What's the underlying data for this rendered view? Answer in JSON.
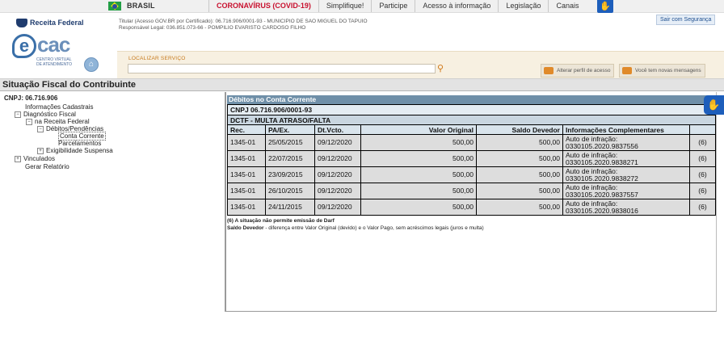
{
  "govbar": {
    "country": "BRASIL",
    "links": [
      "CORONAVÍRUS (COVID-19)",
      "Simplifique!",
      "Participe",
      "Acesso à informação",
      "Legislação",
      "Canais"
    ],
    "accessibility_icon": "hand-accessibility-icon"
  },
  "header": {
    "rf_logo": "Receita Federal",
    "ecac_e": "e",
    "ecac_cac": "cac",
    "ecac_sub": "CENTRO VIRTUAL DE ATENDIMENTO",
    "titular_line1": "Titular (Acesso GOV.BR por Certificado): 06.716.906/0001-93 - MUNICIPIO DE SAO MIGUEL DO TAPUIO",
    "titular_line2": "Responsável Legal: 036.851.073-66 - POMPILIO EVARISTO CARDOSO FILHO",
    "exit_label": "Sair com Segurança",
    "search_label": "LOCALIZAR SERVIÇO",
    "search_value": "",
    "btn_profile": "Alterar perfil de acesso",
    "btn_messages": "Você tem novas mensagens"
  },
  "page_title": "Situação Fiscal do Contribuinte",
  "sidebar": {
    "cnpj": "CNPJ: 06.716.906",
    "items": [
      {
        "label": "Informações Cadastrais",
        "toggle": ""
      },
      {
        "label": "Diagnóstico Fiscal",
        "toggle": "−"
      },
      {
        "label": "na Receita Federal",
        "toggle": "−"
      },
      {
        "label": "Débitos/Pendências",
        "toggle": "−"
      },
      {
        "label": "Conta Corrente",
        "toggle": ""
      },
      {
        "label": "Parcelamentos",
        "toggle": ""
      },
      {
        "label": "Exigibilidade Suspensa",
        "toggle": "+"
      },
      {
        "label": "Vinculados",
        "toggle": "+"
      },
      {
        "label": "Gerar Relatório",
        "toggle": ""
      }
    ]
  },
  "debitos": {
    "title": "Débitos no Conta Corrente",
    "cnpj": "CNPJ 06.716.906/0001-93",
    "group": "DCTF - MULTA ATRASO/FALTA",
    "columns": [
      "Rec.",
      "PA/Ex.",
      "Dt.Vcto.",
      "Valor Original",
      "Saldo Devedor",
      "Informações Complementares",
      ""
    ],
    "rows": [
      {
        "rec": "1345-01",
        "pa": "25/05/2015",
        "vcto": "09/12/2020",
        "valor": "500,00",
        "saldo": "500,00",
        "info1": "Auto de infração:",
        "info2": "0330105.2020.9837556",
        "obs": "(6)"
      },
      {
        "rec": "1345-01",
        "pa": "22/07/2015",
        "vcto": "09/12/2020",
        "valor": "500,00",
        "saldo": "500,00",
        "info1": "Auto de infração:",
        "info2": "0330105.2020.9838271",
        "obs": "(6)"
      },
      {
        "rec": "1345-01",
        "pa": "23/09/2015",
        "vcto": "09/12/2020",
        "valor": "500,00",
        "saldo": "500,00",
        "info1": "Auto de infração:",
        "info2": "0330105.2020.9838272",
        "obs": "(6)"
      },
      {
        "rec": "1345-01",
        "pa": "26/10/2015",
        "vcto": "09/12/2020",
        "valor": "500,00",
        "saldo": "500,00",
        "info1": "Auto de infração:",
        "info2": "0330105.2020.9837557",
        "obs": "(6)"
      },
      {
        "rec": "1345-01",
        "pa": "24/11/2015",
        "vcto": "09/12/2020",
        "valor": "500,00",
        "saldo": "500,00",
        "info1": "Auto de infração:",
        "info2": "0330105.2020.9838016",
        "obs": "(6)"
      }
    ],
    "note1": "(6) A situação não permite emissão de Darf",
    "note2_label": "Saldo Devedor",
    "note2_text": " - diferença entre Valor Original (devido) e o Valor Pago, sem acréscimos legais (juros e multa)"
  },
  "colors": {
    "panel_header": "#6f8fa8",
    "accent_orange": "#d07818",
    "gov_blue": "#1d5ebb"
  }
}
